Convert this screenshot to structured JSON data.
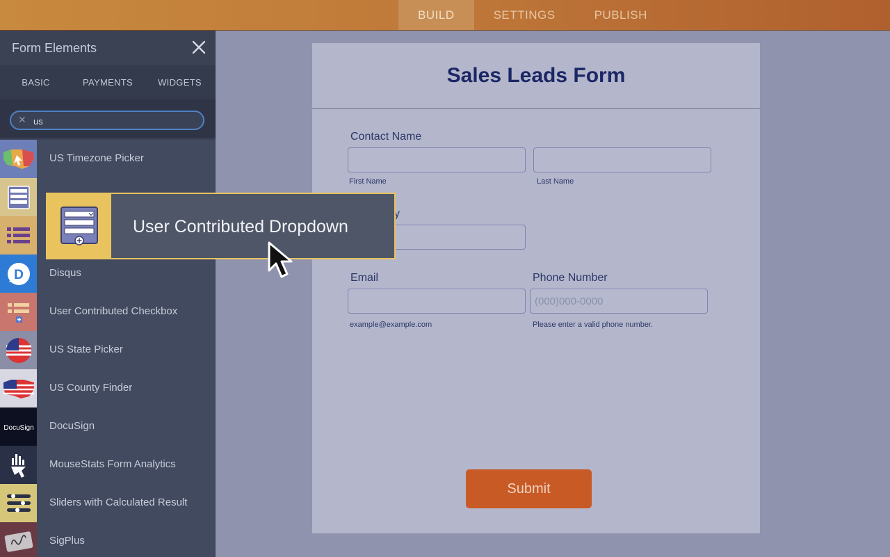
{
  "topbar": {
    "tabs": [
      {
        "label": "BUILD",
        "active": true
      },
      {
        "label": "SETTINGS",
        "active": false
      },
      {
        "label": "PUBLISH",
        "active": false
      }
    ]
  },
  "sidebar": {
    "title": "Form Elements",
    "tabs": [
      {
        "label": "BASIC"
      },
      {
        "label": "PAYMENTS"
      },
      {
        "label": "WIDGETS",
        "active": true
      }
    ],
    "search": {
      "value": "us"
    },
    "items": [
      {
        "label": "US Timezone Picker",
        "icon": "us-map-icon"
      },
      {
        "label": "",
        "icon": "dropdown-list-icon"
      },
      {
        "label": "",
        "icon": "checkbox-list-icon"
      },
      {
        "label": "Disqus",
        "icon": "disqus-icon"
      },
      {
        "label": "User Contributed Checkbox",
        "icon": "checkbox-add-icon"
      },
      {
        "label": "US State Picker",
        "icon": "us-flag-icon"
      },
      {
        "label": "US County Finder",
        "icon": "us-flag-map-icon"
      },
      {
        "label": "DocuSign",
        "icon": "docusign-logo"
      },
      {
        "label": "MouseStats Form Analytics",
        "icon": "mousestats-icon"
      },
      {
        "label": "Sliders with Calculated Result",
        "icon": "sliders-icon"
      },
      {
        "label": "SigPlus",
        "icon": "signature-pad-icon"
      }
    ]
  },
  "drag_item": {
    "label": "User Contributed Dropdown",
    "icon": "dropdown-add-icon"
  },
  "form": {
    "title": "Sales Leads Form",
    "contact_label": "Contact Name",
    "first_name_sub": "First Name",
    "last_name_sub": "Last Name",
    "partial_label": "y",
    "email_label": "Email",
    "email_sub": "example@example.com",
    "phone_label": "Phone Number",
    "phone_placeholder": "(000)000-0000",
    "phone_sub": "Please enter a valid phone number.",
    "submit_label": "Submit"
  }
}
